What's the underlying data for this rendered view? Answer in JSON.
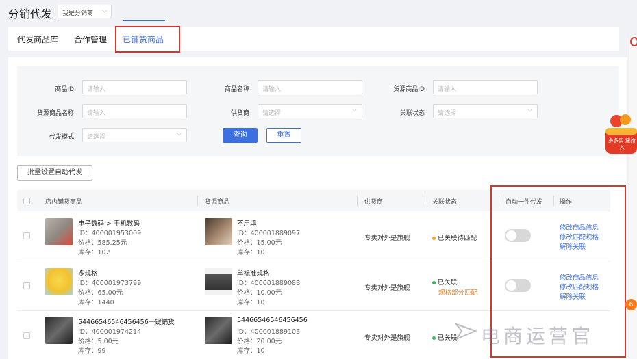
{
  "header": {
    "title": "分销代发",
    "role_select": "我是分销商"
  },
  "tabs": [
    {
      "label": "代发商品库"
    },
    {
      "label": "合作管理"
    },
    {
      "label": "已铺货商品"
    }
  ],
  "filters": {
    "product_id": {
      "label": "商品ID",
      "placeholder": "请输入"
    },
    "product_name": {
      "label": "商品名称",
      "placeholder": "请输入"
    },
    "source_product_id": {
      "label": "货源商品ID",
      "placeholder": "请输入"
    },
    "source_product_name": {
      "label": "货源商品名称",
      "placeholder": "请输入"
    },
    "supplier": {
      "label": "供货商",
      "placeholder": "请选择"
    },
    "link_status": {
      "label": "关联状态",
      "placeholder": "请选择"
    },
    "mode": {
      "label": "代发模式",
      "placeholder": "请选择"
    },
    "query_label": "查询",
    "reset_label": "重置"
  },
  "batch_button": "批量设置自动代发",
  "table": {
    "headers": [
      "店内铺货商品",
      "货源商品",
      "供货商",
      "关联状态",
      "自动一件代发",
      "操作"
    ],
    "rows": [
      {
        "store_product": {
          "title": "电子数码 > 手机数码",
          "id": "ID：400001953009",
          "price": "价格：585.25元",
          "stock": "库存：102"
        },
        "source_product": {
          "title": "不用填",
          "id": "ID：400001889097",
          "price": "价格：15.00元",
          "stock": "库存：10"
        },
        "supplier": "专卖对外是旗舰",
        "status": "已关联待匹配",
        "status_color": "#f5a623",
        "status_sub": "",
        "auto_dropship": false,
        "actions": [
          "修改商品信息",
          "修改匹配规格",
          "解除关联"
        ]
      },
      {
        "store_product": {
          "title": "多规格",
          "id": "ID：400001973799",
          "price": "价格：65.00元",
          "stock": "库存：1440"
        },
        "source_product": {
          "title": "单标准规格",
          "id": "ID：400001889088",
          "price": "价格：10.00元",
          "stock": "库存：10"
        },
        "supplier": "专卖对外是旗舰",
        "status": "已关联",
        "status_color": "#2fb85a",
        "status_sub": "规格部分匹配",
        "auto_dropship": false,
        "actions": [
          "修改商品信息",
          "修改匹配规格",
          "解除关联"
        ]
      },
      {
        "store_product": {
          "title": "54466546546456456一键铺货",
          "id": "ID：400001974214",
          "price": "价格：5.00元",
          "stock": "库存：99"
        },
        "source_product": {
          "title": "54466546546456456",
          "id": "ID：400001889103",
          "price": "价格：20.00元",
          "stock": "库存：10"
        },
        "supplier": "专卖对外是旗舰",
        "status": "已关联",
        "status_color": "#2fb85a",
        "status_sub": "",
        "auto_dropship": false,
        "actions": []
      }
    ]
  },
  "side": {
    "badge_count": "6",
    "promo_text": "多多买 速抢入"
  },
  "watermark": "电商运营官",
  "colors": {
    "accent": "#3c6fe0",
    "highlight_box": "#d9342b",
    "warning": "#e8812b"
  }
}
